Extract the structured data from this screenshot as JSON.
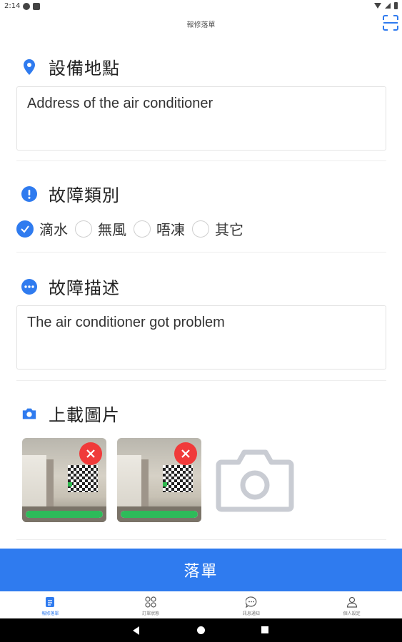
{
  "status_bar": {
    "time": "2:14"
  },
  "header": {
    "title": "報修落單"
  },
  "sections": {
    "location": {
      "title": "設備地點",
      "value": "Address of the air conditioner"
    },
    "fault_type": {
      "title": "故障類別",
      "options": [
        {
          "label": "滴水",
          "selected": true
        },
        {
          "label": "無風",
          "selected": false
        },
        {
          "label": "唔凍",
          "selected": false
        },
        {
          "label": "其它",
          "selected": false
        }
      ]
    },
    "fault_description": {
      "title": "故障描述",
      "value": "The air conditioner got problem"
    },
    "upload": {
      "title": "上載圖片",
      "photos": [
        {
          "upload_progress": 1.0
        },
        {
          "upload_progress": 1.0
        }
      ]
    }
  },
  "submit_label": "落單",
  "bottom_nav": {
    "items": [
      {
        "label": "報修落單",
        "icon": "document-icon",
        "active": true
      },
      {
        "label": "訂單狀態",
        "icon": "grid-icon",
        "active": false
      },
      {
        "label": "訊息通知",
        "icon": "chat-icon",
        "active": false
      },
      {
        "label": "個人設定",
        "icon": "person-icon",
        "active": false
      }
    ]
  },
  "colors": {
    "accent": "#2f7bef",
    "remove": "#f03a3a",
    "progress": "#2dbb5a"
  }
}
